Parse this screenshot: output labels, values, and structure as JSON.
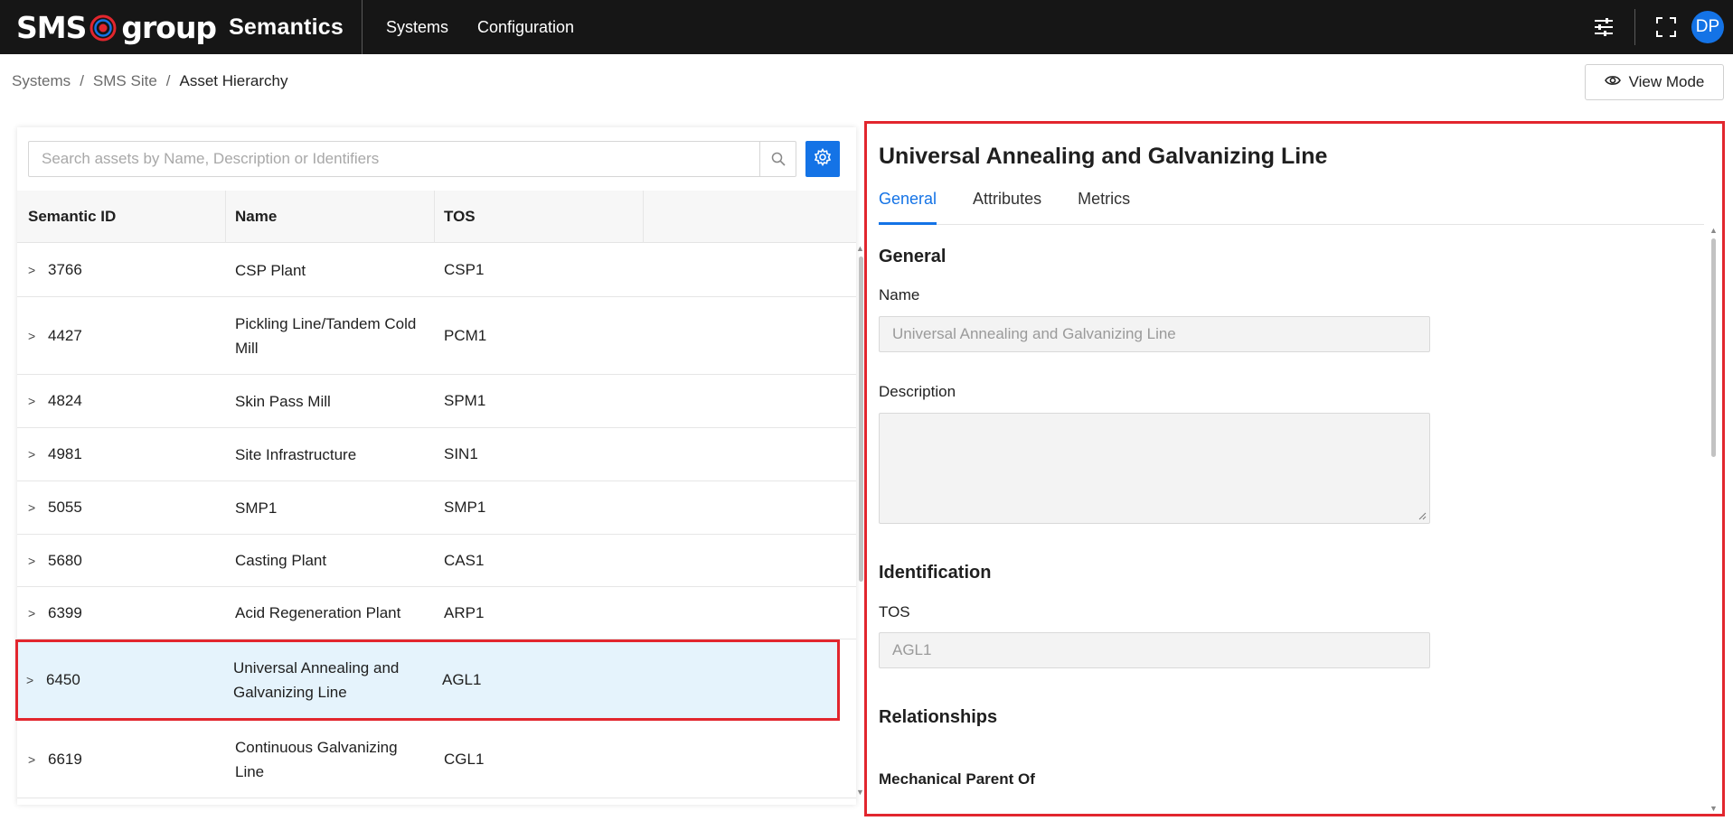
{
  "header": {
    "logo_left": "SMS",
    "logo_right": "group",
    "app_name": "Semantics",
    "nav": [
      {
        "label": "Systems"
      },
      {
        "label": "Configuration"
      }
    ],
    "icons": [
      "sliders-icon",
      "fullscreen-icon"
    ],
    "avatar_initials": "DP",
    "colors": {
      "bar": "#161616",
      "accent": "#1473e6",
      "logo_ring": "#e2262e"
    }
  },
  "breadcrumb": {
    "items": [
      "Systems",
      "SMS Site",
      "Asset Hierarchy"
    ],
    "separator": "/"
  },
  "view_mode": {
    "label": "View Mode",
    "icon": "eye-icon"
  },
  "search": {
    "placeholder": "Search assets by Name, Description or Identifiers",
    "value": ""
  },
  "table": {
    "columns": [
      "Semantic ID",
      "Name",
      "TOS"
    ],
    "rows": [
      {
        "id": "3766",
        "name": "CSP Plant",
        "tos": "CSP1",
        "selected": false
      },
      {
        "id": "4427",
        "name": "Pickling Line/Tandem Cold Mill",
        "tos": "PCM1",
        "selected": false
      },
      {
        "id": "4824",
        "name": "Skin Pass Mill",
        "tos": "SPM1",
        "selected": false
      },
      {
        "id": "4981",
        "name": "Site Infrastructure",
        "tos": "SIN1",
        "selected": false
      },
      {
        "id": "5055",
        "name": "SMP1",
        "tos": "SMP1",
        "selected": false
      },
      {
        "id": "5680",
        "name": "Casting Plant",
        "tos": "CAS1",
        "selected": false
      },
      {
        "id": "6399",
        "name": "Acid Regeneration Plant",
        "tos": "ARP1",
        "selected": false
      },
      {
        "id": "6450",
        "name": "Universal Annealing and Galvanizing Line",
        "tos": "AGL1",
        "selected": true
      },
      {
        "id": "6619",
        "name": "Continuous Galvanizing Line",
        "tos": "CGL1",
        "selected": false
      }
    ]
  },
  "detail": {
    "title": "Universal Annealing and Galvanizing Line",
    "tabs": [
      {
        "label": "General",
        "active": true
      },
      {
        "label": "Attributes",
        "active": false
      },
      {
        "label": "Metrics",
        "active": false
      }
    ],
    "general_section": "General",
    "name_label": "Name",
    "name_value": "Universal Annealing and Galvanizing Line",
    "description_label": "Description",
    "description_value": "",
    "identification_section": "Identification",
    "tos_label": "TOS",
    "tos_value": "AGL1",
    "relationships_section": "Relationships",
    "mechanical_parent_label": "Mechanical Parent Of"
  }
}
